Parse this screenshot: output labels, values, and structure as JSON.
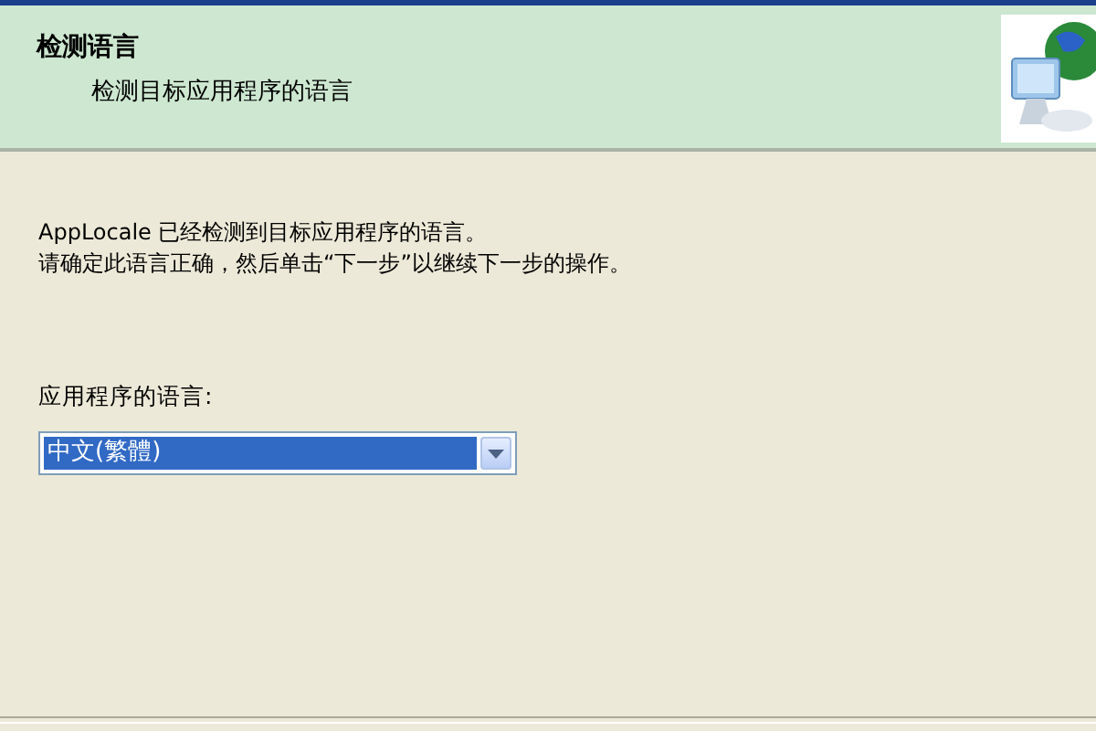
{
  "header": {
    "title": "检测语言",
    "subtitle": "检测目标应用程序的语言"
  },
  "message": [
    "AppLocale 已经检测到目标应用程序的语言。",
    "请确定此语言正确，然后单击“下一步”以继续下一步的操作。"
  ],
  "language_field": {
    "label": "应用程序的语言:",
    "value": "中文(繁體)",
    "focused": true
  }
}
